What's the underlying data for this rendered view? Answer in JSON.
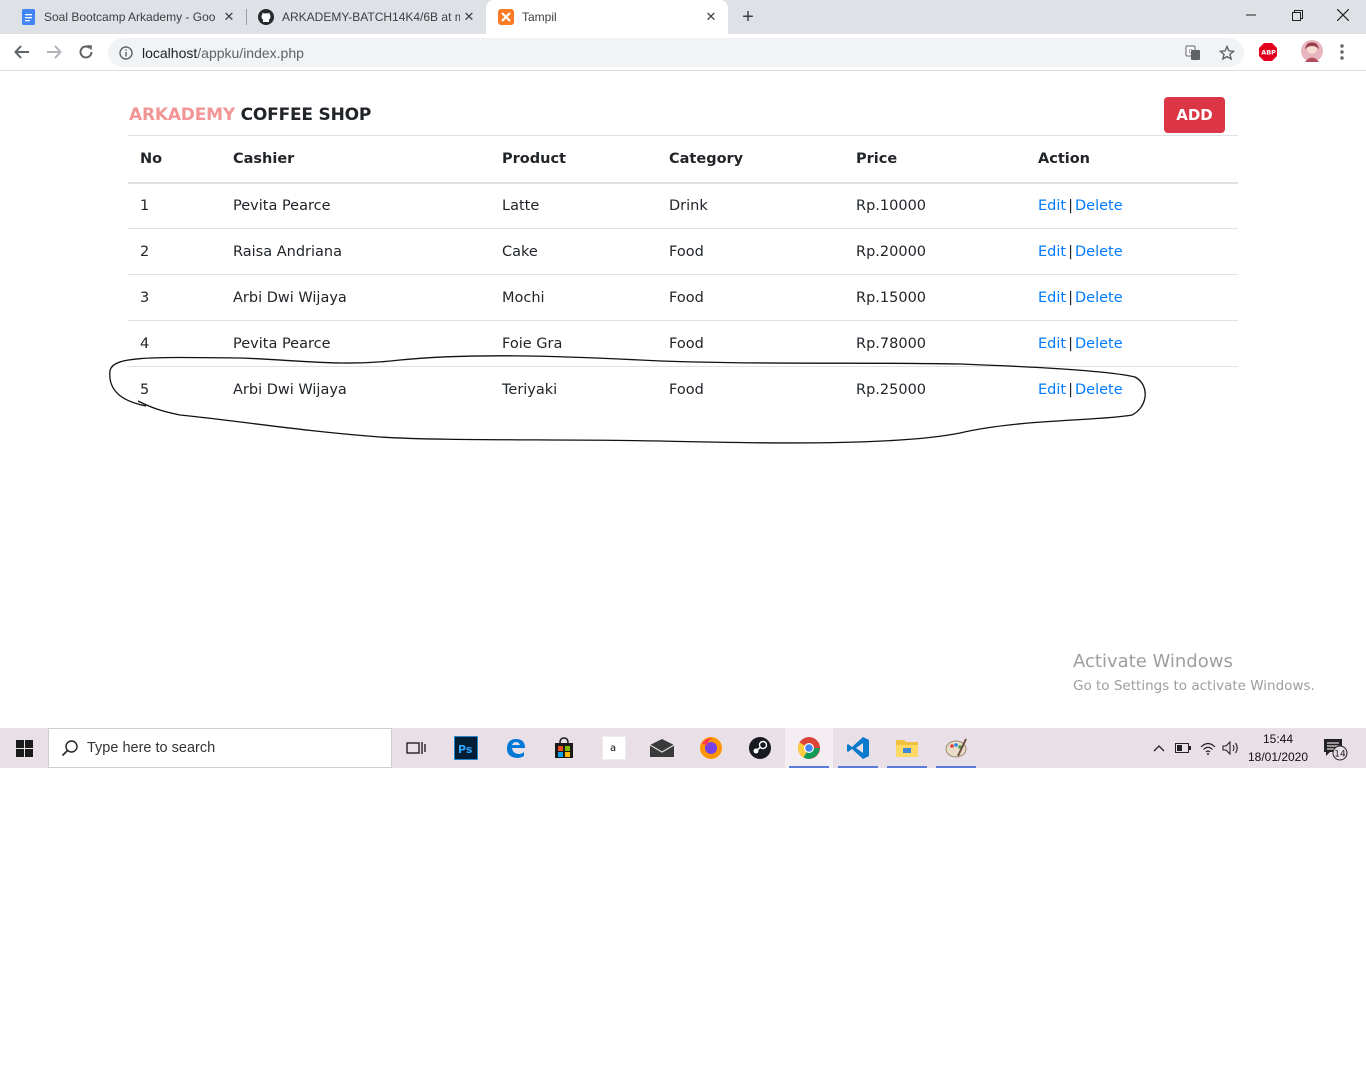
{
  "browser": {
    "tabs": [
      {
        "title": "Soal Bootcamp Arkademy - Goo",
        "active": false,
        "favicon": "google-docs-icon"
      },
      {
        "title": "ARKADEMY-BATCH14K4/6B at m",
        "active": false,
        "favicon": "github-icon"
      },
      {
        "title": "Tampil",
        "active": true,
        "favicon": "xampp-icon"
      }
    ],
    "url_host": "localhost",
    "url_path": "/appku/index.php",
    "extensions": [
      "translate-icon",
      "star-icon",
      "adblock-plus-icon",
      "profile-avatar-icon",
      "menu-dots-icon"
    ]
  },
  "app": {
    "brand_part1": "ARKADEMY",
    "brand_part2": "COFFEE SHOP",
    "add_label": "ADD",
    "colors": {
      "brand_accent": "#f39596",
      "danger": "#dc3545",
      "link": "#007bff"
    },
    "table": {
      "headers": [
        "No",
        "Cashier",
        "Product",
        "Category",
        "Price",
        "Action"
      ],
      "rows": [
        {
          "no": "1",
          "cashier": "Pevita Pearce",
          "product": "Latte",
          "category": "Drink",
          "price": "Rp.10000",
          "edit": "Edit",
          "sep": "|",
          "delete": "Delete"
        },
        {
          "no": "2",
          "cashier": "Raisa Andriana",
          "product": "Cake",
          "category": "Food",
          "price": "Rp.20000",
          "edit": "Edit",
          "sep": "|",
          "delete": "Delete"
        },
        {
          "no": "3",
          "cashier": "Arbi Dwi Wijaya",
          "product": "Mochi",
          "category": "Food",
          "price": "Rp.15000",
          "edit": "Edit",
          "sep": "|",
          "delete": "Delete"
        },
        {
          "no": "4",
          "cashier": "Pevita Pearce",
          "product": "Foie Gra",
          "category": "Food",
          "price": "Rp.78000",
          "edit": "Edit",
          "sep": "|",
          "delete": "Delete"
        },
        {
          "no": "5",
          "cashier": "Arbi Dwi Wijaya",
          "product": "Teriyaki",
          "category": "Food",
          "price": "Rp.25000",
          "edit": "Edit",
          "sep": "|",
          "delete": "Delete"
        }
      ]
    }
  },
  "watermark": {
    "line1": "Activate Windows",
    "line2": "Go to Settings to activate Windows."
  },
  "taskbar": {
    "search_placeholder": "Type here to search",
    "apps": [
      "task-view-icon",
      "photoshop-icon",
      "edge-icon",
      "store-icon",
      "amazon-icon",
      "mail-icon",
      "firefox-icon",
      "steam-icon",
      "chrome-icon",
      "vscode-icon",
      "file-explorer-icon",
      "paint-icon"
    ],
    "amazon_glyph": "a",
    "photoshop_glyph": "Ps",
    "time": "15:44",
    "date": "18/01/2020",
    "notification_count": "14"
  }
}
